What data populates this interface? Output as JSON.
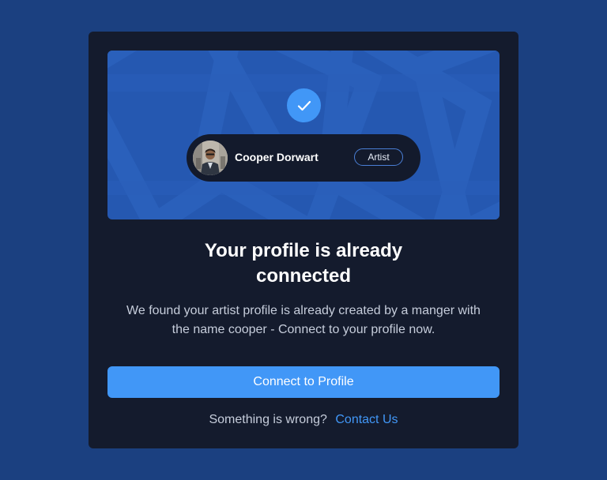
{
  "hero": {
    "profile": {
      "name": "Cooper Dorwart",
      "role": "Artist"
    }
  },
  "title": {
    "line1": "Your profile is already",
    "line2": "connected"
  },
  "description": {
    "line1": "We found your artist profile is already created by a manger with",
    "line2": "the name cooper - Connect to your profile now."
  },
  "actions": {
    "connect_label": "Connect to Profile"
  },
  "footer": {
    "prompt": "Something is wrong?",
    "link_label": "Contact Us"
  },
  "icons": {
    "check": "check-icon",
    "avatar": "avatar-photo"
  },
  "colors": {
    "page_background": "#1b4080",
    "card_background": "#141b2d",
    "hero_background": "#2558b1",
    "accent": "#4197f7"
  }
}
